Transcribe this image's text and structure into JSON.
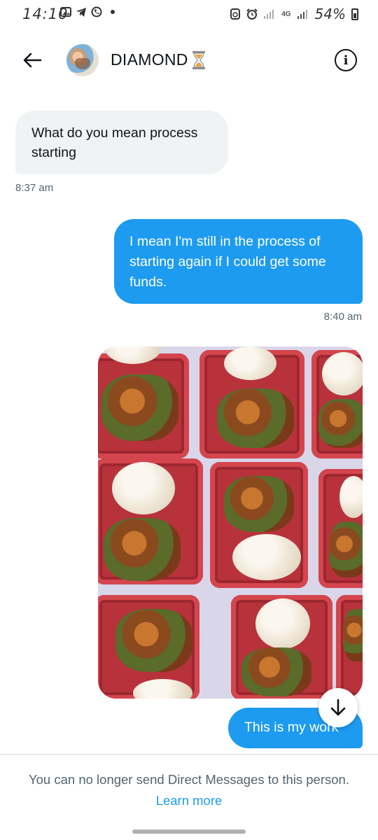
{
  "status_bar": {
    "time": "14:10",
    "battery": "54%",
    "network": "4G"
  },
  "header": {
    "contact_name": "DIAMOND",
    "status_emoji_icon": "hourglass-icon",
    "back_icon": "arrow-left-icon",
    "info_icon": "info-icon"
  },
  "messages": [
    {
      "direction": "incoming",
      "text": "What do you mean process starting",
      "time": "8:37 am"
    },
    {
      "direction": "outgoing",
      "text": "I mean I'm still in the process of starting again if I could get some funds.",
      "time": "8:40 am"
    },
    {
      "direction": "outgoing",
      "type": "image",
      "image_icon": "food-trays-photo"
    },
    {
      "direction": "outgoing",
      "text": "This is my work"
    }
  ],
  "footer": {
    "notice": "You can no longer send Direct Messages to this person.",
    "link": "Learn more"
  },
  "colors": {
    "accent": "#1d9bf0",
    "incoming_bubble": "#eff3f4",
    "text_secondary": "#536471"
  }
}
